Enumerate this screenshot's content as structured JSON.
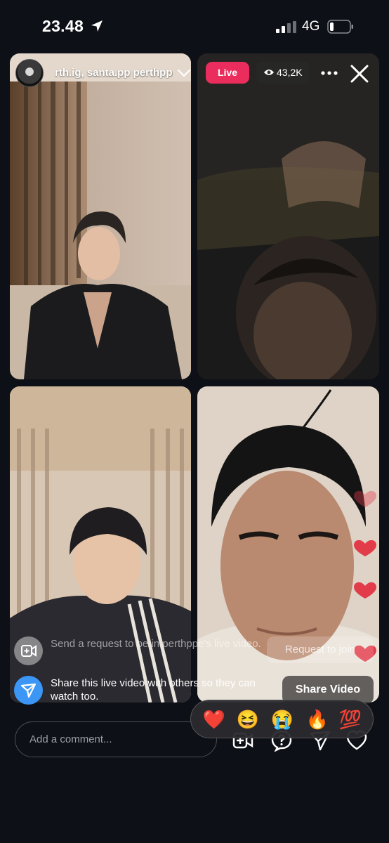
{
  "status_bar": {
    "time": "23.48",
    "network": "4G"
  },
  "live": {
    "host_names": "rth.ig, santa.pp  perthppe",
    "badge": "Live",
    "viewer_count": "43,2K"
  },
  "notices": [
    {
      "text": "Send a request to be in perthppe's live video.",
      "action": "Request to join"
    },
    {
      "text": "Share this live video with others so they can watch too.",
      "action": "Share Video"
    }
  ],
  "comment": {
    "placeholder": "Add a comment..."
  },
  "reactions": [
    "❤️",
    "😆",
    "😭",
    "🔥",
    "💯"
  ],
  "colors": {
    "live_badge": "#ea2d5c",
    "share_icon": "#3b96f5",
    "background": "#0d1016"
  },
  "icons": {
    "status": [
      "location-arrow-icon",
      "signal-icon",
      "battery-icon"
    ],
    "header": [
      "eye-icon",
      "more-icon",
      "close-icon",
      "chevron-down-icon"
    ],
    "bottom": [
      "add-video-icon",
      "question-icon",
      "send-icon",
      "heart-icon"
    ]
  }
}
